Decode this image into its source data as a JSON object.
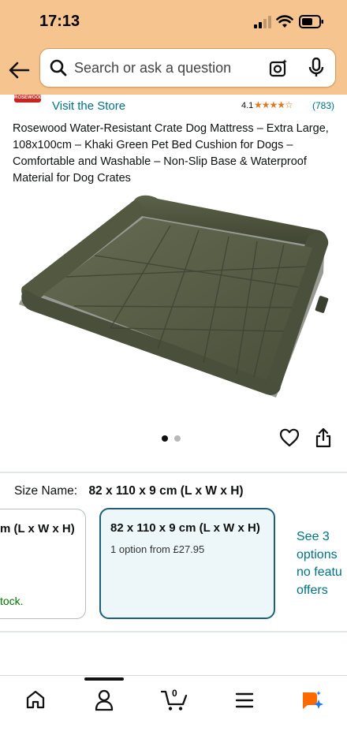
{
  "status_bar": {
    "time": "17:13"
  },
  "search": {
    "placeholder": "Search or ask a question"
  },
  "store": {
    "logo_text": "ROSEWOOD",
    "visit_label": "Visit the Store",
    "rating": "4.1",
    "stars": "★★★★☆",
    "review_count": "(783)"
  },
  "product": {
    "title": "Rosewood Water-Resistant Crate Dog Mattress – Extra Large, 108x100cm – Khaki Green Pet Bed Cushion for Dogs – Comfortable and Washable – Non-Slip Base & Waterproof Material for Dog Crates",
    "image_icon": "dog-bed-image",
    "carousel_total": 2,
    "carousel_active": 1
  },
  "size": {
    "label": "Size Name:",
    "selected_value": "82 x 110 x 9 cm (L x W x H)",
    "cards": [
      {
        "title": "m (L x W x H)",
        "availability": "tock."
      },
      {
        "title": "82 x 110 x 9 cm (L x W x H)",
        "subtitle": "1 option from £27.95"
      }
    ],
    "see_options": [
      "See 3",
      "options",
      "no featu",
      "offers"
    ]
  },
  "bottom_nav": {
    "items": [
      "home-icon",
      "account-icon",
      "cart-icon",
      "menu-icon",
      "rufus-icon"
    ],
    "cart_count": "0"
  },
  "colors": {
    "header_bg": "#f6c58f",
    "link": "#007185",
    "star": "#de7921",
    "selected_border": "#1f5f7a",
    "in_stock": "#007600"
  }
}
